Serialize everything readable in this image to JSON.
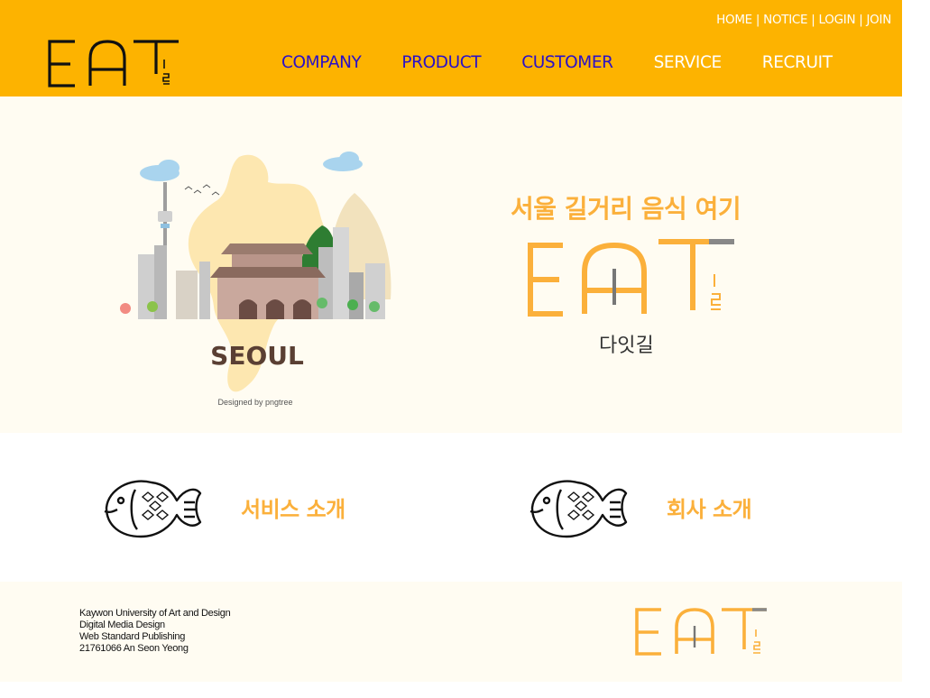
{
  "colors": {
    "header_bg": "#fdb300",
    "accent": "#fbb03b",
    "visited_link": "#2a10c8",
    "hero_bg": "#fffcf2"
  },
  "header": {
    "logo_icon": "eat-logo-icon",
    "util_links": [
      "HOME",
      "NOTICE",
      "LOGIN",
      "JOIN"
    ],
    "util_separator": "|",
    "nav": [
      {
        "label": "COMPANY",
        "visited": true
      },
      {
        "label": "PRODUCT",
        "visited": true
      },
      {
        "label": "CUSTOMER",
        "visited": true
      },
      {
        "label": "SERVICE",
        "visited": false
      },
      {
        "label": "RECRUIT",
        "visited": false
      }
    ]
  },
  "hero": {
    "illustration_icon": "seoul-illustration",
    "illustration_text": "SEOUL",
    "illustration_credit": "Designed by pngtree",
    "slogan": "서울 길거리 음식 여기",
    "logo_icon": "eat-logo-icon",
    "brand_name": "다잇길"
  },
  "quick_links": [
    {
      "icon": "taiyaki-fish-icon",
      "label": "서비스 소개"
    },
    {
      "icon": "taiyaki-fish-icon",
      "label": "회사 소개"
    }
  ],
  "footer": {
    "info_lines": [
      "Kaywon University of Art and Design",
      "Digital Media Design",
      "Web Standard Publishing",
      "21761066 An Seon Yeong"
    ],
    "logo_icon": "eat-logo-icon"
  }
}
